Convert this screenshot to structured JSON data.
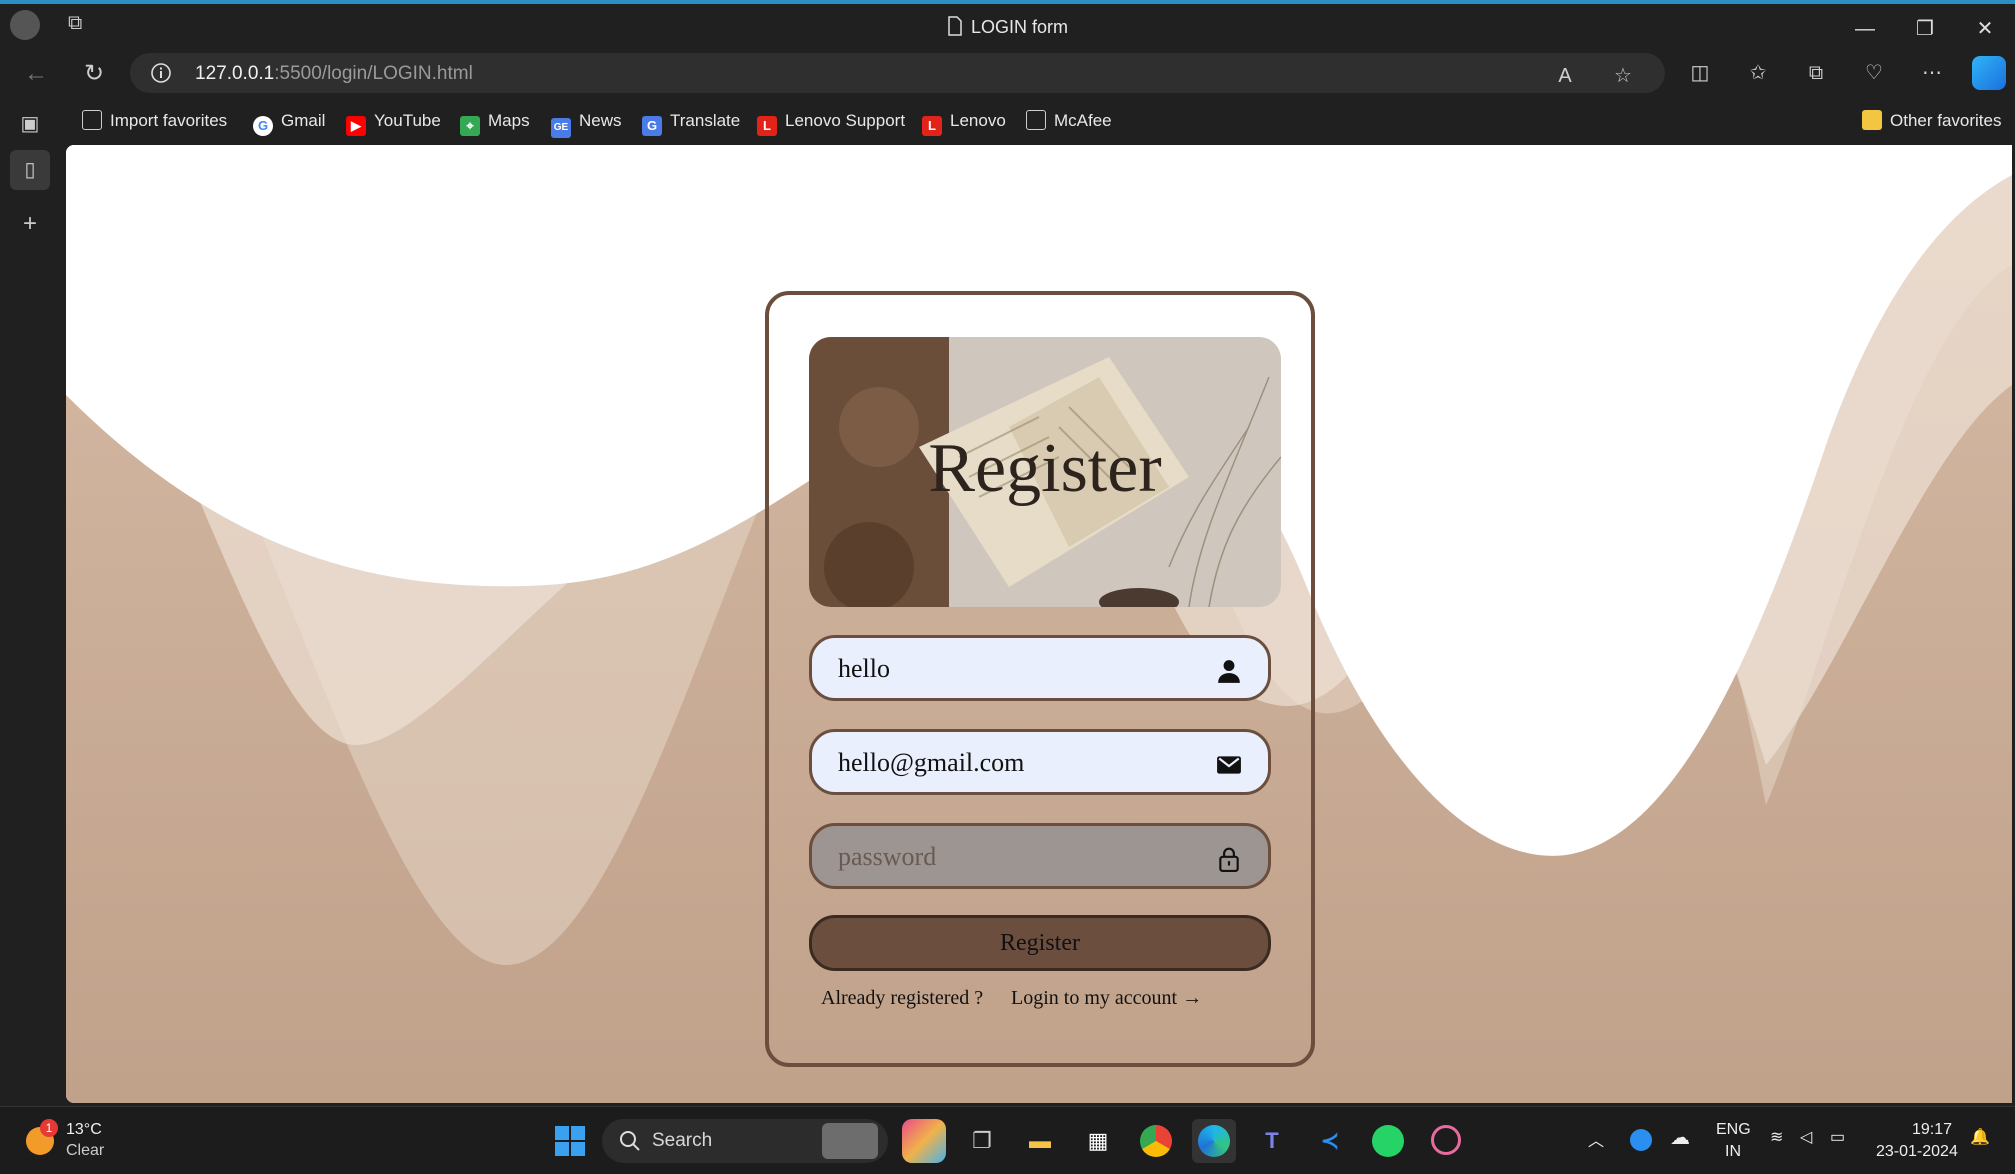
{
  "window": {
    "title": "LOGIN form",
    "minimize": "—",
    "restore": "❐",
    "close": "✕"
  },
  "address_bar": {
    "url_host": "127.0.0.1",
    "url_path": ":5500/login/LOGIN.html"
  },
  "favorites": [
    {
      "label": "Import favorites",
      "icon": "import-icon"
    },
    {
      "label": "Gmail",
      "icon": "google-icon"
    },
    {
      "label": "YouTube",
      "icon": "youtube-icon"
    },
    {
      "label": "Maps",
      "icon": "maps-icon"
    },
    {
      "label": "News",
      "icon": "news-icon"
    },
    {
      "label": "Translate",
      "icon": "translate-icon"
    },
    {
      "label": "Lenovo Support",
      "icon": "lenovo-icon"
    },
    {
      "label": "Lenovo",
      "icon": "lenovo-icon"
    },
    {
      "label": "McAfee",
      "icon": "page-icon"
    }
  ],
  "other_favorites": "Other favorites",
  "form": {
    "heading": "Register",
    "username_value": "hello",
    "email_value": "hello@gmail.com",
    "password_placeholder": "password",
    "submit_label": "Register",
    "already_text": "Already registered ?",
    "login_link": "Login to my account →"
  },
  "taskbar": {
    "weather_temp": "13°C",
    "weather_desc": "Clear",
    "weather_badge": "1",
    "search_label": "Search",
    "lang_top": "ENG",
    "lang_bottom": "IN",
    "time": "19:17",
    "date": "23-01-2024"
  },
  "colors": {
    "card_border": "#6b4e3d",
    "field_fill": "#e9effc",
    "button_fill": "#6b4e3d",
    "background_sand": "#c4a48c"
  }
}
